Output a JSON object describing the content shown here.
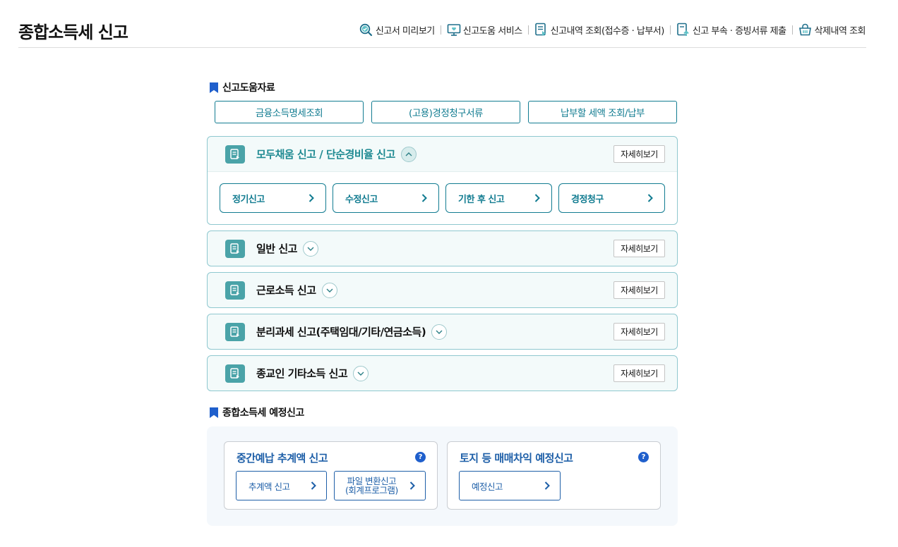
{
  "page_title": "종합소득세 신고",
  "top_links": [
    {
      "label": "신고서 미리보기",
      "icon": "magnifier-check-icon"
    },
    {
      "label": "신고도움 서비스",
      "icon": "monitor-heart-icon"
    },
    {
      "label": "신고내역 조회(접수증 · 납부서)",
      "icon": "document-list-icon"
    },
    {
      "label": "신고 부속 · 증빙서류 제출",
      "icon": "document-upload-icon"
    },
    {
      "label": "삭제내역 조회",
      "icon": "basket-icon"
    }
  ],
  "help_section": {
    "heading": "신고도움자료",
    "buttons": [
      "금융소득명세조회",
      "(고용)경정청구서류",
      "납부할 세액 조회/납부"
    ]
  },
  "panels": [
    {
      "title": "모두채움 신고 / 단순경비율 신고",
      "detail_label": "자세히보기",
      "expanded": true,
      "sub_buttons": [
        "정기신고",
        "수정신고",
        "기한 후 신고",
        "경정청구"
      ]
    },
    {
      "title": "일반 신고",
      "detail_label": "자세히보기",
      "expanded": false
    },
    {
      "title": "근로소득 신고",
      "detail_label": "자세히보기",
      "expanded": false
    },
    {
      "title": "분리과세 신고(주택임대/기타/연금소득)",
      "detail_label": "자세히보기",
      "expanded": false
    },
    {
      "title": "종교인 기타소득 신고",
      "detail_label": "자세히보기",
      "expanded": false
    }
  ],
  "estimated_section": {
    "heading": "종합소득세 예정신고",
    "cards": [
      {
        "title": "중간예납 추계액 신고",
        "buttons": [
          {
            "line1": "추계액 신고"
          },
          {
            "line1": "파일 변환신고",
            "line2": "(회계프로그램)"
          }
        ]
      },
      {
        "title": "토지 등 매매차익 예정신고",
        "buttons": [
          {
            "line1": "예정신고"
          }
        ]
      }
    ]
  },
  "colors": {
    "accent_teal": "#127c91",
    "panel_border": "#8fc8cf",
    "panel_bg": "#f3fafa",
    "icon_teal": "#4aa3a8",
    "blue_title": "#1e5fa8",
    "bookmark_blue": "#1f5fcc"
  }
}
